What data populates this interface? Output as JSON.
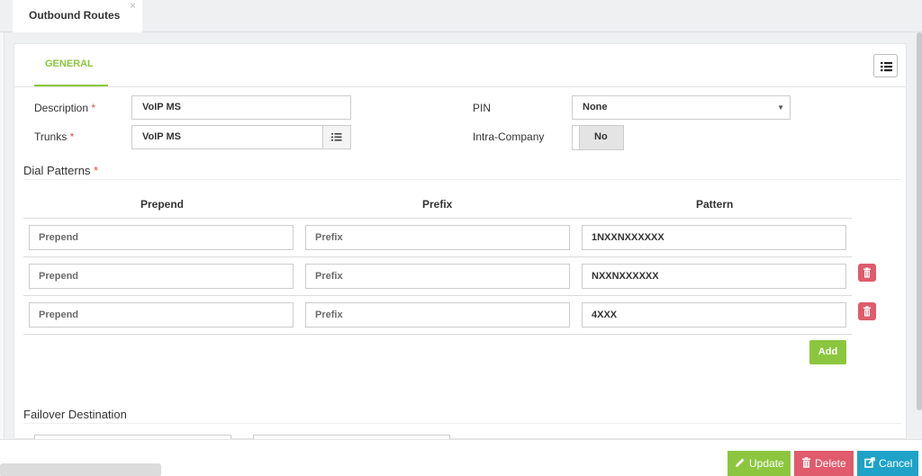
{
  "tab": {
    "label": "Outbound Routes",
    "close": "×"
  },
  "general_tab": "GENERAL",
  "form": {
    "description_label": "Description",
    "description_value": "VoIP MS",
    "trunks_label": "Trunks",
    "trunks_value": "VoIP MS",
    "pin_label": "PIN",
    "pin_value": "None",
    "intra_label": "Intra-Company",
    "intra_value": "No",
    "required_mark": "*"
  },
  "dial_patterns": {
    "title": "Dial Patterns",
    "headers": [
      "Prepend",
      "Prefix",
      "Pattern"
    ],
    "rows": [
      {
        "prepend": "Prepend",
        "prefix": "Prefix",
        "pattern": "1NXXNXXXXXX"
      },
      {
        "prepend": "Prepend",
        "prefix": "Prefix",
        "pattern": "NXXNXXXXXX"
      },
      {
        "prepend": "Prepend",
        "prefix": "Prefix",
        "pattern": "4XXX"
      }
    ],
    "add_label": "Add"
  },
  "failover": {
    "title": "Failover Destination"
  },
  "footer": {
    "update": "Update",
    "delete": "Delete",
    "cancel": "Cancel"
  },
  "colors": {
    "accent": "#8cc63f",
    "danger": "#e05b6c",
    "info": "#1fa2c8"
  }
}
